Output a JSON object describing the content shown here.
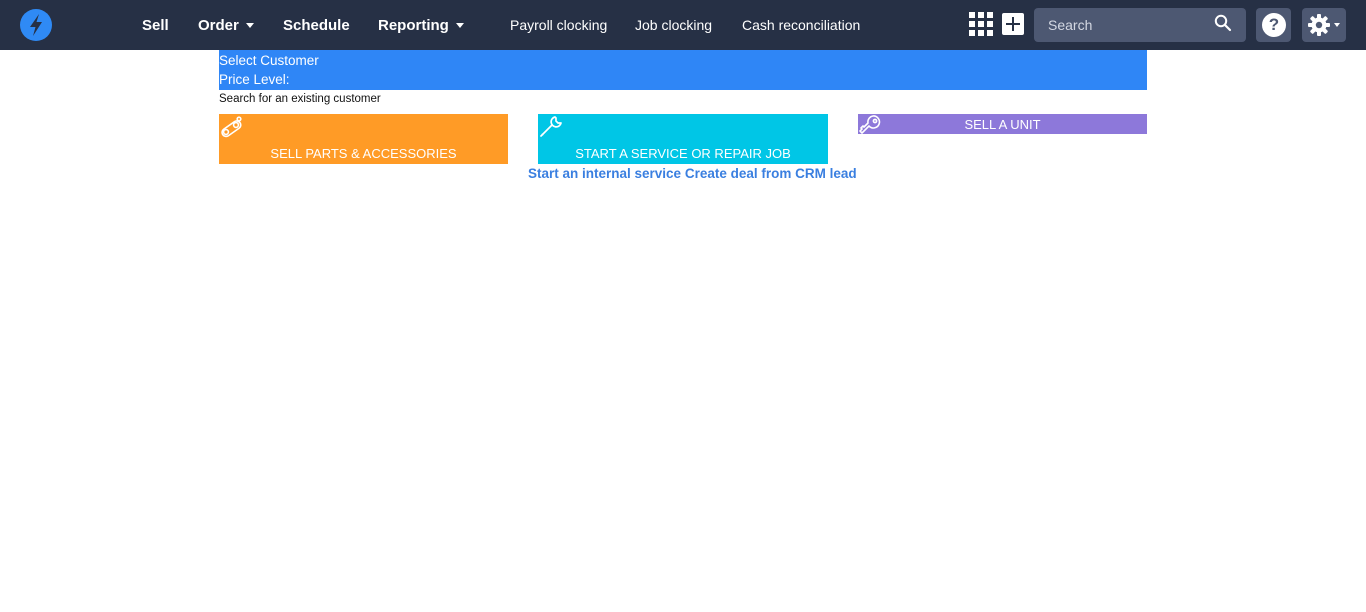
{
  "nav": {
    "logo_icon": "lightning-bolt-icon",
    "items": [
      {
        "label": "Sell",
        "dropdown": false
      },
      {
        "label": "Order",
        "dropdown": true
      },
      {
        "label": "Schedule",
        "dropdown": false
      },
      {
        "label": "Reporting",
        "dropdown": true
      }
    ],
    "secondary": [
      "Payroll clocking",
      "Job clocking",
      "Cash reconciliation"
    ],
    "search_placeholder": "Search",
    "help_label": "?",
    "icons": [
      "apps-grid-icon",
      "plus-icon",
      "search-icon",
      "help-icon",
      "gear-icon"
    ]
  },
  "customer": {
    "select_label": "Select Customer",
    "price_level_label": "Price Level:",
    "search_link": "Search for an existing customer"
  },
  "tiles": {
    "parts": {
      "label": "SELL PARTS & ACCESSORIES",
      "icon": "gear-chain-icon",
      "color": "#ff9b26"
    },
    "service": {
      "label": "START A SERVICE OR REPAIR JOB",
      "icon": "wrench-icon",
      "color": "#00c6e6"
    },
    "unit": {
      "label": "SELL A UNIT",
      "icon": "key-icon",
      "color": "#8d78da"
    }
  },
  "links": {
    "internal_service": "Start an internal service",
    "crm_deal": "Create deal from CRM lead"
  },
  "colors": {
    "topbar": "#263045",
    "accent_blue": "#2f86f6",
    "link_blue": "#3a7fe0"
  }
}
